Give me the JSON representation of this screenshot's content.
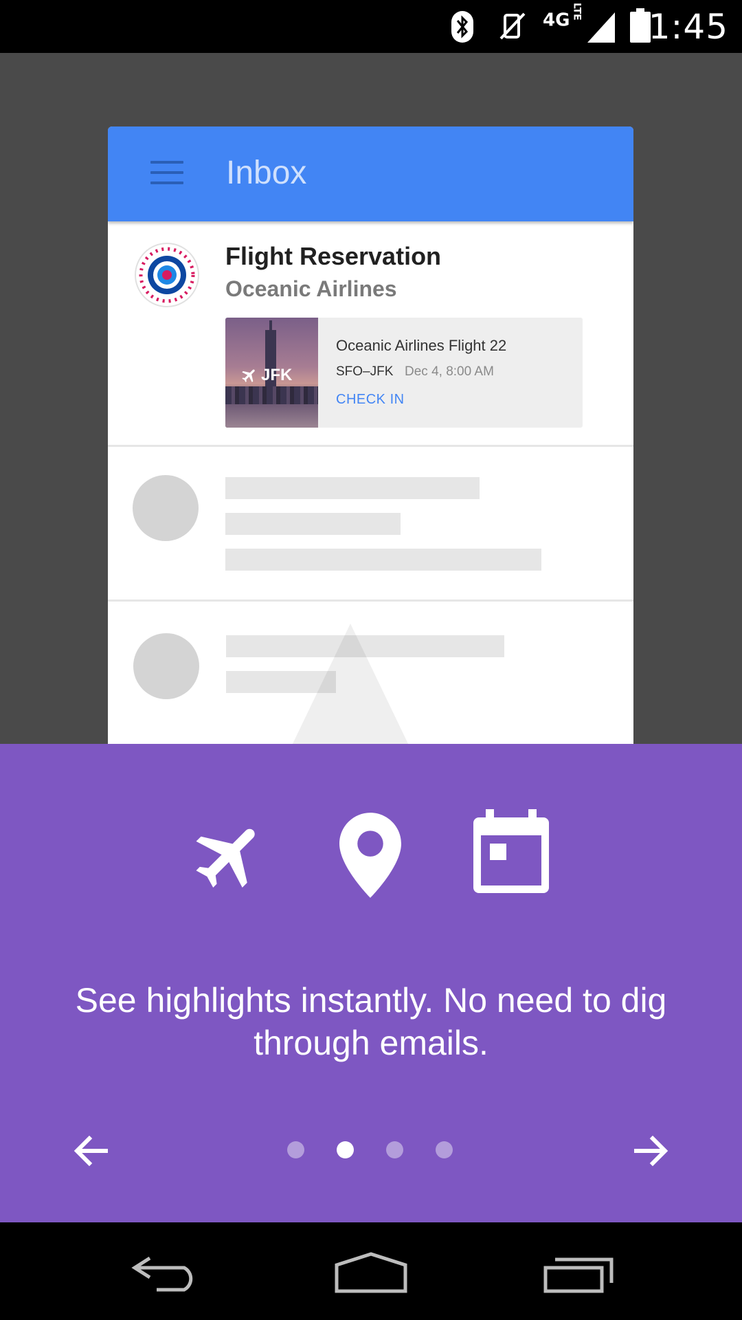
{
  "status_bar": {
    "time": "1:45",
    "network": "4G",
    "network_sub": "LTE",
    "icons": [
      "bluetooth-icon",
      "vibrate-off-icon",
      "signal-icon",
      "battery-icon"
    ]
  },
  "app_preview": {
    "appbar_title": "Inbox",
    "accent_color": "#4285f4",
    "email": {
      "subject": "Flight Reservation",
      "sender": "Oceanic Airlines",
      "flight_card": {
        "image_label": "JFK",
        "title": "Oceanic Airlines Flight 22",
        "route": "SFO–JFK",
        "date": "Dec 4, 8:00 AM",
        "action": "CHECK IN"
      }
    }
  },
  "onboarding": {
    "background_color": "#7e57c2",
    "icons": [
      "airplane-icon",
      "location-pin-icon",
      "calendar-icon"
    ],
    "headline": "See highlights instantly. No need to dig through emails.",
    "page_index": 2,
    "page_count": 4
  },
  "nav_bar": {
    "buttons": [
      "back-icon",
      "home-icon",
      "recents-icon"
    ]
  }
}
